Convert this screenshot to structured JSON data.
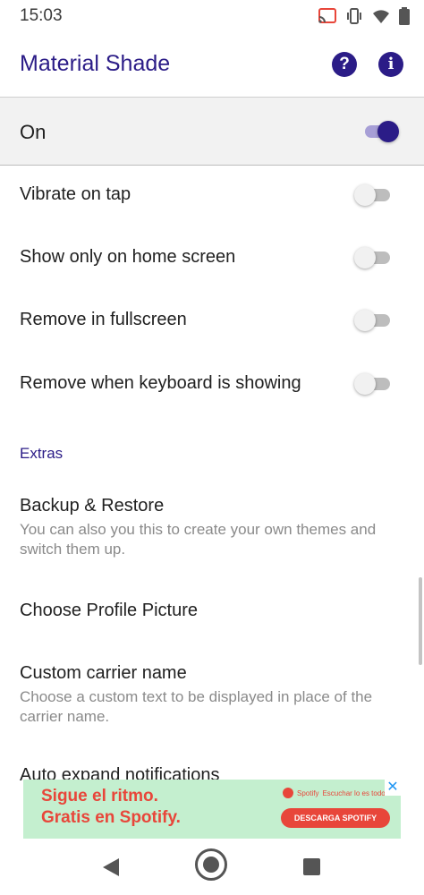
{
  "status_bar": {
    "time": "15:03",
    "icons": [
      "cast-icon",
      "vibrate-icon",
      "wifi-icon",
      "battery-icon"
    ]
  },
  "app_bar": {
    "title": "Material Shade",
    "help_icon": "?",
    "info_icon": "i"
  },
  "master": {
    "label": "On",
    "enabled": true
  },
  "settings": [
    {
      "label": "Vibrate on tap",
      "enabled": false
    },
    {
      "label": "Show only on home screen",
      "enabled": false
    },
    {
      "label": "Remove in fullscreen",
      "enabled": false
    },
    {
      "label": "Remove when keyboard is showing",
      "enabled": false
    }
  ],
  "extras": {
    "header": "Extras",
    "items": [
      {
        "title": "Backup & Restore",
        "summary": "You can also you this to create your own themes and switch them up."
      },
      {
        "title": "Choose Profile Picture",
        "summary": ""
      },
      {
        "title": "Custom carrier name",
        "summary": "Choose a custom text to be displayed in place of the carrier name."
      },
      {
        "title": "Auto expand notifications",
        "summary": ""
      }
    ]
  },
  "ad": {
    "headline": "Sigue el ritmo.\nGratis en Spotify.",
    "brand": "Spotify",
    "tagline": "Escuchar lo es todo",
    "cta": "DESCARGA SPOTIFY",
    "close": "✕"
  },
  "colors": {
    "accent": "#2b1c87",
    "ad_background": "#c4efcf",
    "ad_accent": "#e8463a"
  }
}
